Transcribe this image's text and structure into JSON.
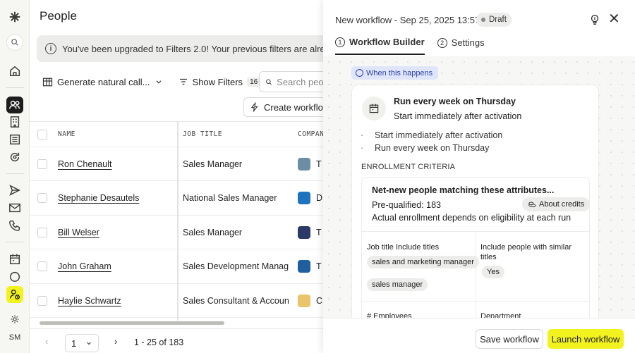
{
  "nav": {
    "avatar": "SM",
    "colors": {
      "active": "#1d1d1d",
      "accent": "#f2f21e"
    },
    "icons": [
      "logo-icon",
      "search-icon",
      "home-icon",
      "people-icon",
      "company-icon",
      "list-icon",
      "refresh-icon",
      "send-icon",
      "mail-icon",
      "phone-icon",
      "calendar-icon",
      "circle-icon",
      "workflow-user-icon",
      "settings-icon"
    ]
  },
  "main": {
    "title": "People",
    "banner": "You've been upgraded to Filters 2.0! Your previous filters are already",
    "toolbar": {
      "generate": "Generate natural call...",
      "show_filters": "Show Filters",
      "filters_count": "16",
      "search_placeholder": "Search people",
      "create_workflow": "Create workflow"
    },
    "table": {
      "headers": {
        "name": "NAME",
        "job": "JOB TITLE",
        "company": "COMPANY"
      },
      "rows": [
        {
          "name": "Ron Chenault",
          "job": "Sales Manager",
          "company": "T",
          "logo_color": "#6c8ea5"
        },
        {
          "name": "Stephanie Desautels",
          "job": "National Sales Manager",
          "company": "D",
          "logo_color": "#1e73be"
        },
        {
          "name": "Bill Welser",
          "job": "Sales Manager",
          "company": "T",
          "logo_color": "#2b3a66"
        },
        {
          "name": "John Graham",
          "job": "Sales Development Manag",
          "company": "T",
          "logo_color": "#1f5f9e"
        },
        {
          "name": "Haylie Schwartz",
          "job": "Sales Consultant & Accoun",
          "company": "C",
          "logo_color": "#e9c46a"
        }
      ]
    },
    "pager": {
      "page": "1",
      "range": "1 - 25 of 183"
    }
  },
  "panel": {
    "title": "New workflow - Sep 25, 2025 13:57",
    "status": "Draft",
    "tabs": [
      {
        "num": "1",
        "label": "Workflow Builder"
      },
      {
        "num": "2",
        "label": "Settings"
      }
    ],
    "trigger_label": "When this happens",
    "schedule": {
      "title": "Run every week on Thursday",
      "subtitle": "Start immediately after activation",
      "bullets": [
        "Start immediately after activation",
        "Run every week on Thursday"
      ],
      "bullet_char": "·"
    },
    "criteria": {
      "label": "ENROLLMENT CRITERIA",
      "title": "Net-new people matching these attributes...",
      "prequalified": "Pre-qualified: 183",
      "credits": "About credits",
      "note": "Actual enrollment depends on eligibility at each run",
      "job_title_label": "Job title Include titles",
      "job_titles": [
        "sales and marketing manager",
        "sales manager"
      ],
      "similar_label": "Include people with similar titles",
      "similar_value": "Yes",
      "employees_label": "# Employees",
      "department_label": "Department"
    },
    "footer": {
      "save": "Save workflow",
      "launch": "Launch workflow"
    }
  }
}
